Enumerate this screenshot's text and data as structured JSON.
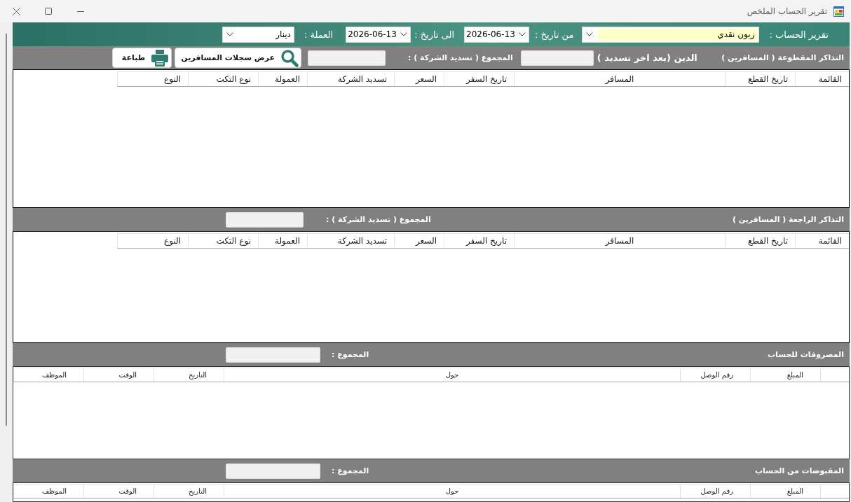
{
  "window": {
    "title": "تقرير الحساب الملخص"
  },
  "filters": {
    "account": {
      "label": "تقرير الحساب :",
      "value": "زبون نقدي"
    },
    "from_date": {
      "label": "من تاريخ :",
      "value": "2026-06-13"
    },
    "to_date": {
      "label": "الى تاريخ :",
      "value": "2026-06-13"
    },
    "currency": {
      "label": "العملة :",
      "value": "دينار"
    }
  },
  "sections": [
    {
      "kind": "tickets",
      "title": "التذاكر المقطوعة ( المسافرين )",
      "debt_label": "الدين (بعد اخر تسديد )",
      "total_label": "المجموع ( تسديد الشركة ) :",
      "buttons": [
        {
          "kind": "search",
          "label": "عرض سجلات المسافرين"
        },
        {
          "kind": "print",
          "label": "طباعة"
        }
      ],
      "columns": [
        "القائمة",
        "تاريخ القطع",
        "المسافر",
        "تاريخ السفر",
        "السعر",
        "تسديد الشركة",
        "العمولة",
        "نوع التكت",
        "النوع"
      ]
    },
    {
      "kind": "tickets",
      "title": "التذاكر الراجعة ( المسافرين )",
      "total_label": "المجموع ( تسديد الشركة ) :",
      "columns": [
        "القائمة",
        "تاريخ القطع",
        "المسافر",
        "تاريخ السفر",
        "السعر",
        "تسديد الشركة",
        "العمولة",
        "نوع التكت",
        "النوع"
      ]
    },
    {
      "kind": "ledger",
      "title": "المصروفات للحساب",
      "total_label": "المجموع :",
      "columns": [
        "المبلغ",
        "رقم الوصل",
        "حول",
        "التاريخ",
        "الوقت",
        "الموظف"
      ]
    },
    {
      "kind": "ledger",
      "title": "المقبوضات من الحساب",
      "total_label": "المجموع :",
      "columns": [
        "المبلغ",
        "رقم الوصل",
        "حول",
        "التاريخ",
        "الوقت",
        "الموظف"
      ]
    }
  ]
}
